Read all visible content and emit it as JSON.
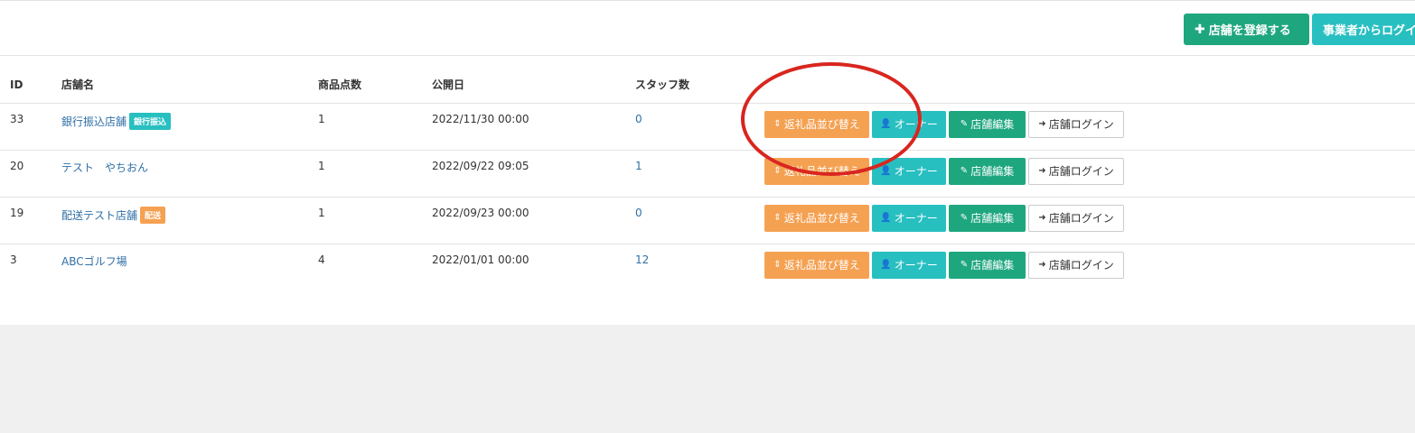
{
  "toolbar": {
    "register_store": "店舗を登録する",
    "login_from_business": "事業者からログイン"
  },
  "table": {
    "headers": [
      "ID",
      "店舗名",
      "商品点数",
      "公開日",
      "スタッフ数",
      ""
    ],
    "rows": [
      {
        "id": "33",
        "name": "銀行振込店舗",
        "badge": "銀行振込",
        "count": "1",
        "date": "2022/11/30 00:00",
        "staff": "0"
      },
      {
        "id": "20",
        "name": "テスト　やちおん",
        "badge": "",
        "count": "1",
        "date": "2022/09/22 09:05",
        "staff": "1"
      },
      {
        "id": "19",
        "name": "配送テスト店舗",
        "badge": "配送",
        "count": "1",
        "date": "2022/09/23 00:00",
        "staff": "0"
      },
      {
        "id": "3",
        "name": "ABCゴルフ場",
        "badge": "",
        "count": "4",
        "date": "2022/01/01 00:00",
        "staff": "12"
      }
    ],
    "actions": {
      "sort": "返礼品並び替え",
      "owner": "オーナー",
      "edit": "店舗編集",
      "login": "店舗ログイン"
    }
  },
  "colors": {
    "green": "#1ea67f",
    "teal": "#28bfc1",
    "orange": "#f5a152",
    "link": "#2f6fa6",
    "annotation_red": "#d8261f"
  },
  "icons": {
    "register": "plus-icon",
    "sort": "sort-icon",
    "owner": "user-icon",
    "edit": "edit-icon",
    "login": "sign-in-icon"
  }
}
